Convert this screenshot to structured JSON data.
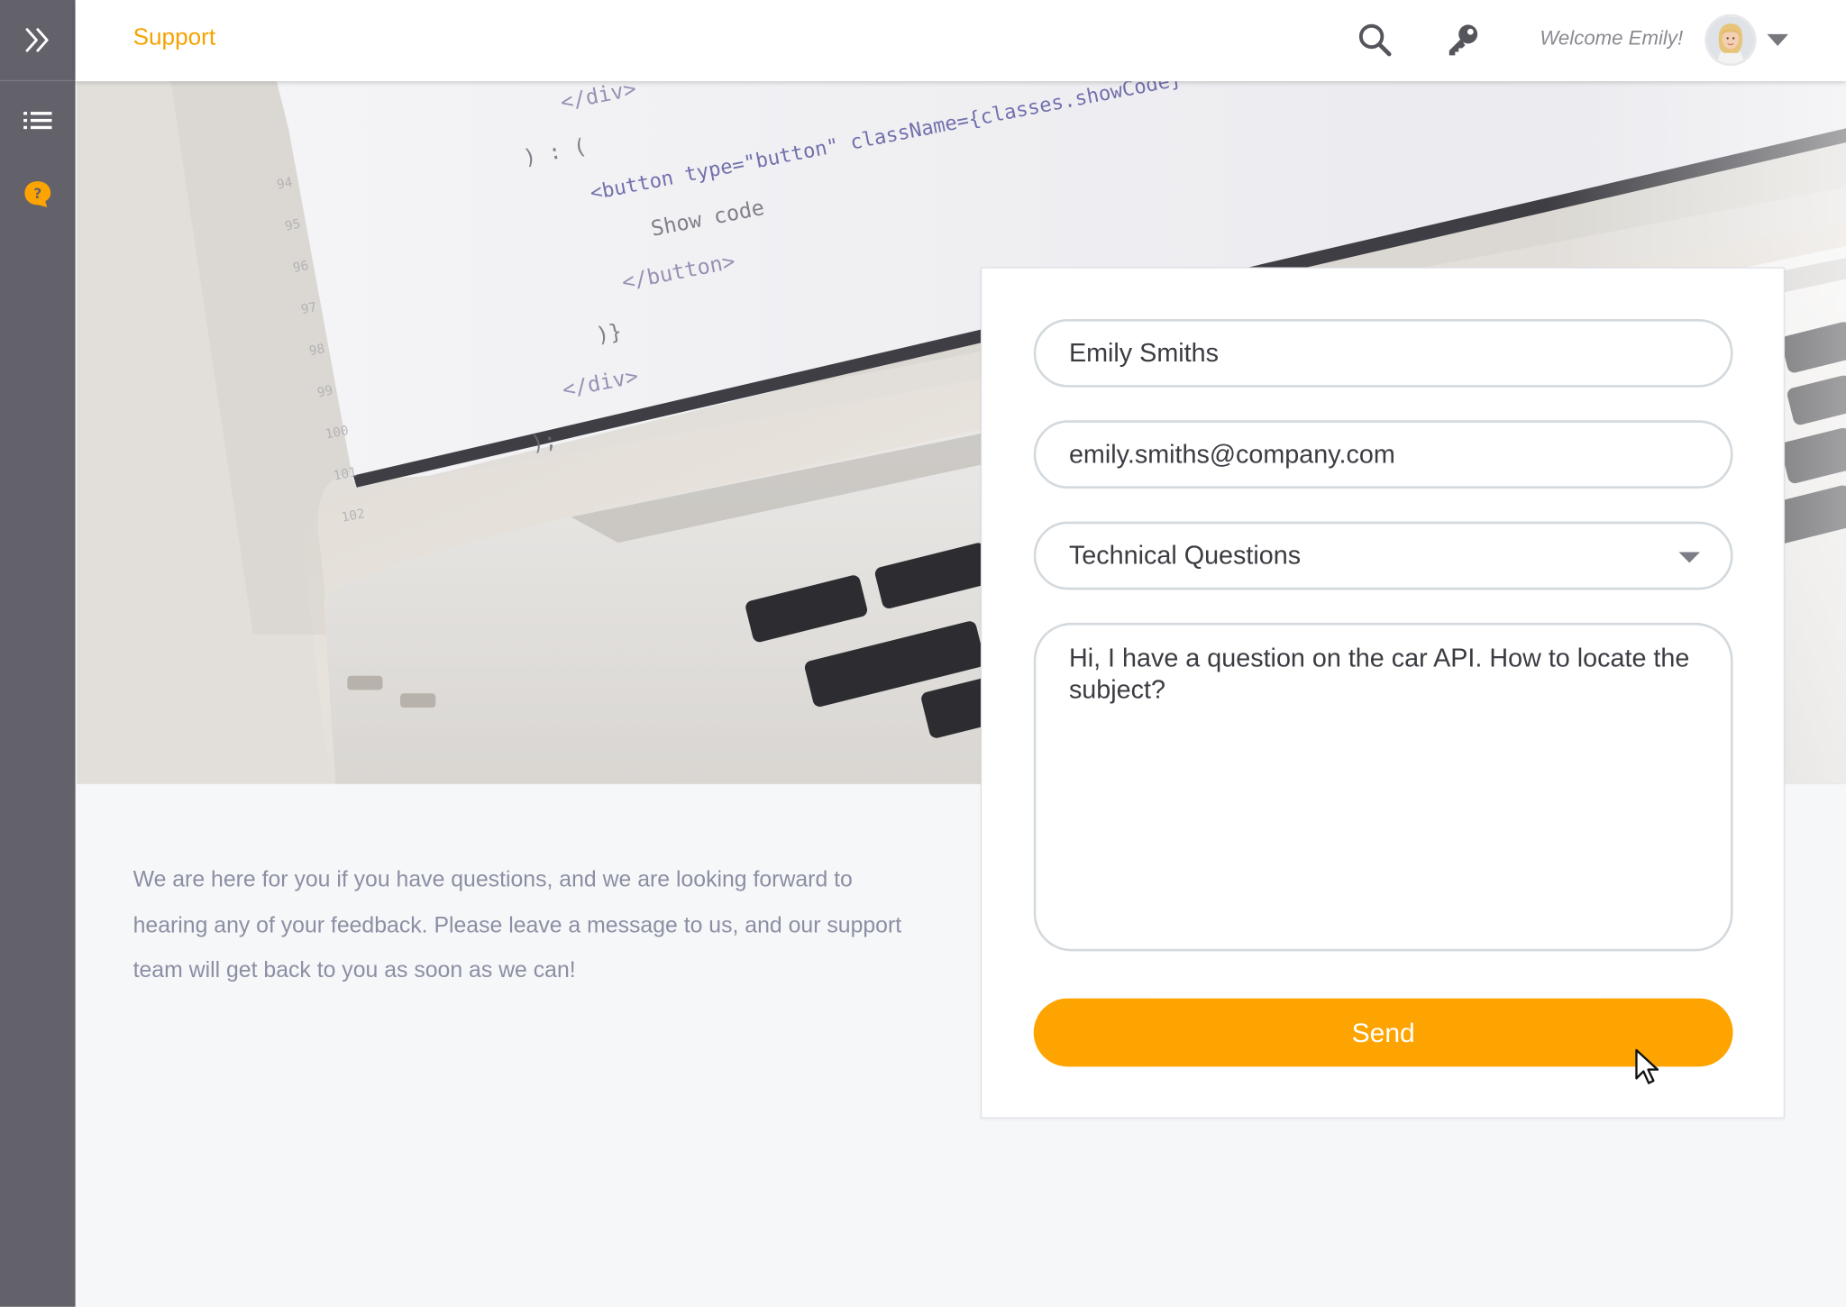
{
  "header": {
    "title": "Support",
    "welcome": "Welcome Emily!",
    "icons": [
      "search-icon",
      "key-icon",
      "user-avatar",
      "chevron-down-icon"
    ]
  },
  "sidebar": {
    "icons": [
      "double-chevron-right-icon",
      "list-icon",
      "help-bubble-icon"
    ],
    "active_item": "help-bubble-icon"
  },
  "intro": {
    "text": "We are here for you if you have questions, and we are looking forward to hearing any of your feedback. Please leave a message to us, and our support team will get back to you as soon as we can!"
  },
  "form": {
    "name_value": "Emily Smiths",
    "email_value": "emily.smiths@company.com",
    "topic_selected": "Technical Questions",
    "message_value": "Hi, I have a question on the car API. How to locate the subject?",
    "send_label": "Send"
  },
  "hero": {
    "code_lines": [
      "</div>",
      ") : (",
      "<button type=\"button\" className={classes.showCode}",
      "Show code",
      "</button>",
      ")}",
      "</div>",
      ");"
    ],
    "line_numbers": [
      "94",
      "95",
      "96",
      "97",
      "98",
      "99",
      "100",
      "101",
      "102"
    ]
  },
  "colors": {
    "accent": "#fea400",
    "title": "#f5a300",
    "sidebar_bg": "#63626b",
    "page_bg": "#f6f7f9",
    "intro_text": "#8b8fa3"
  }
}
